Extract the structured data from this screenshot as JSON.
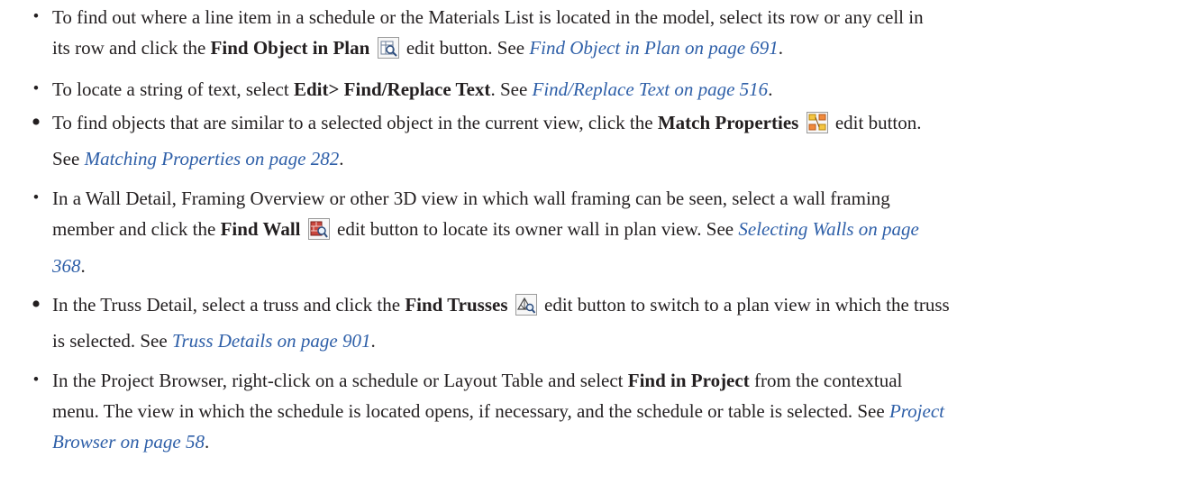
{
  "items": [
    {
      "line1_a": "To find out where a line item in  a schedule or the Materials List is located in the model, select its row or any cell in",
      "line2_a": "its row and click the ",
      "line2_bold": "Find Object in Plan",
      "line2_c": " edit button. See ",
      "line2_link": "Find Object in Plan on page 691",
      "line2_end": ".",
      "icon": "find-object-in-plan-icon"
    },
    {
      "text_a": "To locate a string of text, select ",
      "bold": "Edit> Find/Replace Text",
      "text_b": ". See ",
      "link": "Find/Replace Text on page 516",
      "end": "."
    },
    {
      "line1_a": "To find objects that are similar to a selected object in the current view, click the ",
      "line1_bold": "Match Properties",
      "line1_c": " edit button.",
      "line2_a": "See ",
      "line2_link": "Matching Properties on page 282",
      "line2_end": ".",
      "icon": "match-properties-icon"
    },
    {
      "line1": "In a  Wall Detail, Framing Overview or other 3D view in which wall framing can be seen, select a wall framing",
      "line2_a": "member and click the ",
      "line2_bold": "Find Wall",
      "line2_c": " edit button to locate its owner wall in plan view. See ",
      "line2_link": "Selecting Walls on page",
      "line3_link": "368",
      "line3_end": ".",
      "icon": "find-wall-icon"
    },
    {
      "line1_a": "In the Truss Detail, select a truss and click the ",
      "line1_bold": "Find Trusses",
      "line1_c": " edit button to switch to a plan view in which the truss",
      "line2_a": "is selected. See ",
      "line2_link": "Truss Details on page 901",
      "line2_end": ".",
      "icon": "find-trusses-icon"
    },
    {
      "line1_a": "In the Project Browser, right-click on a schedule or Layout Table and select ",
      "line1_bold": "Find in Project",
      "line1_c": " from the contextual",
      "line2": "menu. The view in which the schedule is located opens, if necessary, and the schedule or table is selected. See ",
      "line2_link": "Project",
      "line3_link": "Browser on page 58",
      "line3_end": "."
    }
  ]
}
